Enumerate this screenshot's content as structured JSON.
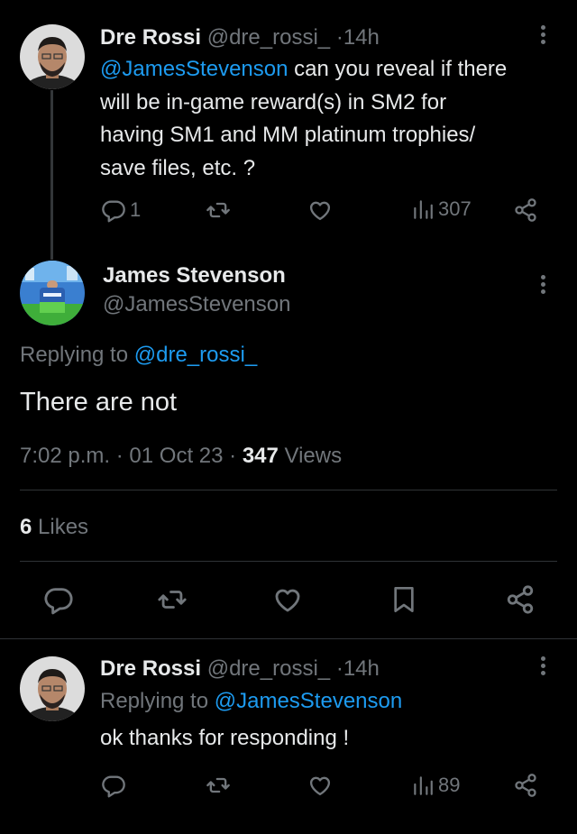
{
  "tweet1": {
    "author_name": "Dre Rossi",
    "author_handle": "@dre_rossi_",
    "dot": "·",
    "time": "14h",
    "mention": "@JamesStevenson",
    "text_line1_rest": " can you reveal if there",
    "text_line2": "will be in-game reward(s) in SM2 for",
    "text_line3": "having SM1 and MM platinum trophies/",
    "text_line4": "save files, etc. ?",
    "reply_count": "1",
    "view_count": "307"
  },
  "main_tweet": {
    "author_name": "James Stevenson",
    "author_handle": "@JamesStevenson",
    "replying_prefix": "Replying to ",
    "replying_handle": "@dre_rossi_",
    "text": "There are not",
    "time": "7:02 p.m.",
    "dot": "·",
    "date": "01 Oct 23",
    "views_count": "347",
    "views_label": " Views",
    "likes_count": "6",
    "likes_label": " Likes"
  },
  "tweet3": {
    "author_name": "Dre Rossi",
    "author_handle": "@dre_rossi_",
    "dot": "·",
    "time": "14h",
    "replying_prefix": "Replying to ",
    "replying_handle": "@JamesStevenson",
    "text": "ok thanks for responding !",
    "view_count": "89"
  },
  "icons": [
    "reply-icon",
    "retweet-icon",
    "like-icon",
    "views-icon",
    "share-icon",
    "bookmark-icon",
    "more-icon"
  ],
  "colors": {
    "background": "#000000",
    "text": "#e7e9ea",
    "muted": "#71767b",
    "link": "#1d9bf0",
    "divider": "#2f3336"
  }
}
